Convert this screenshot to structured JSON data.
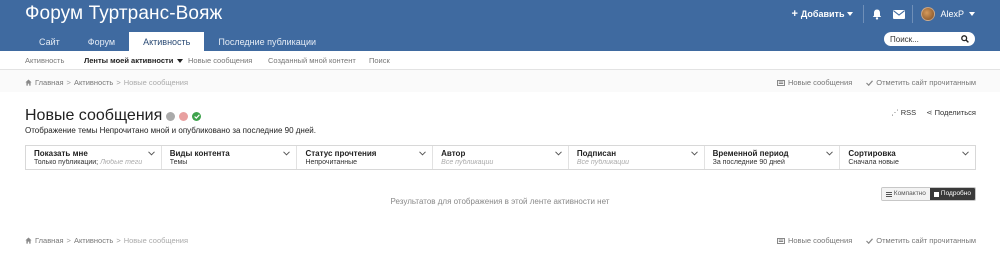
{
  "header": {
    "site_title": "Форум Туртранс-Вояж",
    "add_label": "Добавить",
    "username": "AlexP",
    "search_placeholder": "Поиск..."
  },
  "tabs": [
    {
      "label": "Сайт"
    },
    {
      "label": "Форум"
    },
    {
      "label": "Активность",
      "active": true
    },
    {
      "label": "Последние публикации"
    }
  ],
  "subnav": [
    {
      "label": "Активность"
    },
    {
      "label": "Ленты моей активности",
      "active": true
    },
    {
      "label": "Новые сообщения"
    },
    {
      "label": "Созданный мной контент"
    },
    {
      "label": "Поиск"
    }
  ],
  "breadcrumb": {
    "home": "Главная",
    "section": "Активность",
    "current": "Новые сообщения"
  },
  "actions": {
    "new_posts": "Новые сообщения",
    "mark_read": "Отметить сайт прочитанным"
  },
  "page": {
    "title": "Новые сообщения",
    "rss": "RSS",
    "share": "Поделиться",
    "description": "Отображение темы Непрочитано мной и опубликовано за последние 90 дней."
  },
  "filters": [
    {
      "label": "Показать мне",
      "value": "Только публикации;",
      "value_muted": "Любые теги"
    },
    {
      "label": "Виды контента",
      "value": "Темы",
      "value_muted": ""
    },
    {
      "label": "Статус прочтения",
      "value": "Непрочитанные",
      "value_muted": ""
    },
    {
      "label": "Автор",
      "value": "",
      "value_muted": "Все публикации"
    },
    {
      "label": "Подписан",
      "value": "",
      "value_muted": "Все публикации"
    },
    {
      "label": "Временной период",
      "value": "За последние 90 дней",
      "value_muted": ""
    },
    {
      "label": "Сортировка",
      "value": "Сначала новые",
      "value_muted": ""
    }
  ],
  "view_toggle": {
    "compact": "Компактно",
    "detailed": "Подробно"
  },
  "empty_message": "Результатов для отображения в этой ленте активности нет",
  "colors": {
    "header_bg": "#3f6aa0",
    "follow_green": "#3fa34d",
    "ignore_red": "#e06c6c"
  }
}
